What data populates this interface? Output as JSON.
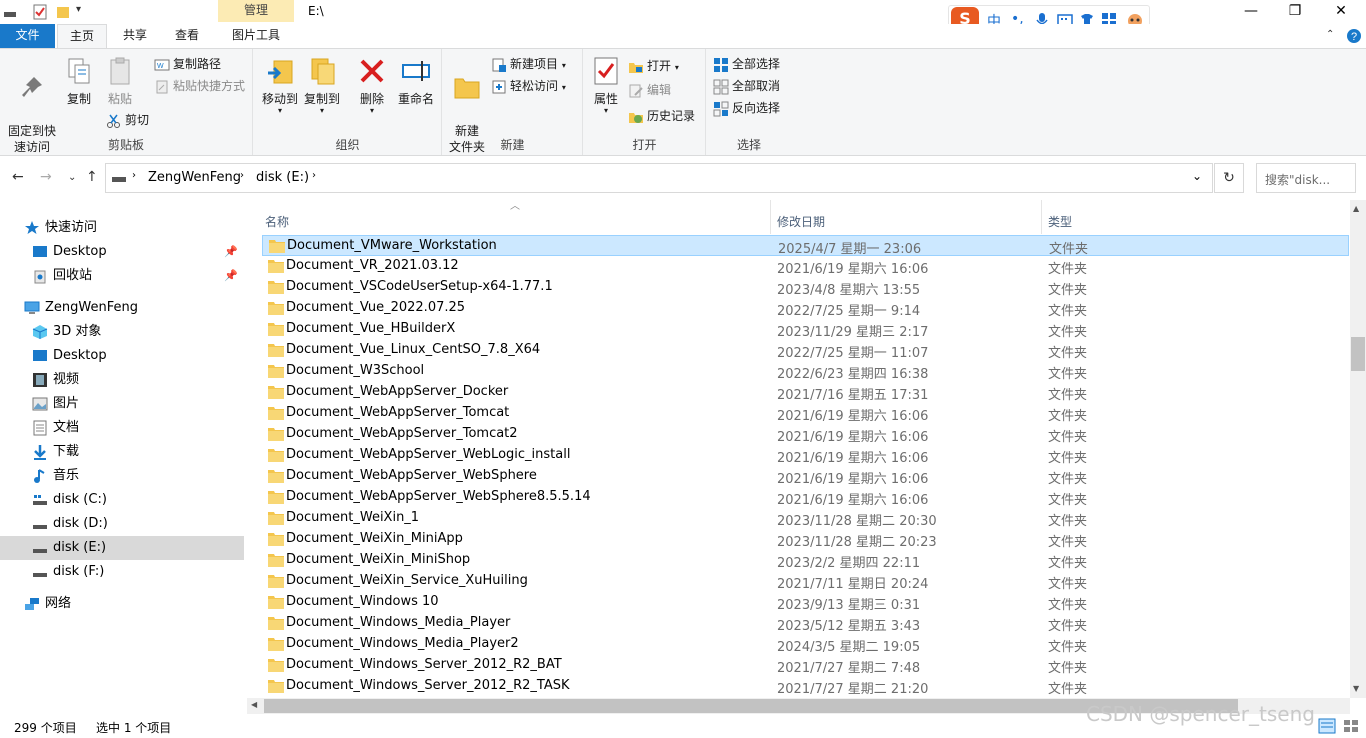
{
  "window": {
    "title": "E:\\",
    "context_tab": "管理",
    "controls": {
      "minimize": "—",
      "maximize": "❐",
      "close": "✕"
    }
  },
  "ime": {
    "logo": "S",
    "mode": "中",
    "punct": "•,"
  },
  "tabs": [
    {
      "label": "文件"
    },
    {
      "label": "主页"
    },
    {
      "label": "共享"
    },
    {
      "label": "查看"
    },
    {
      "label": "图片工具"
    }
  ],
  "ribbon": {
    "clipboard": {
      "label": "剪贴板",
      "pin": "固定到快\n速访问",
      "copy": "复制",
      "paste": "粘贴",
      "copy_path": "复制路径",
      "paste_shortcut": "粘贴快捷方式",
      "cut": "剪切"
    },
    "organize": {
      "label": "组织",
      "move_to": "移动到",
      "copy_to": "复制到",
      "delete": "删除",
      "rename": "重命名"
    },
    "new": {
      "label": "新建",
      "new_folder": "新建\n文件夹",
      "new_item": "新建项目",
      "easy_access": "轻松访问"
    },
    "open": {
      "label": "打开",
      "properties": "属性",
      "open": "打开",
      "edit": "编辑",
      "history": "历史记录"
    },
    "select": {
      "label": "选择",
      "select_all": "全部选择",
      "select_none": "全部取消",
      "invert": "反向选择"
    }
  },
  "address": {
    "crumbs": [
      "ZengWenFeng",
      "disk (E:)"
    ],
    "search_placeholder": "搜索\"disk..."
  },
  "navpane": {
    "quick_access": "快速访问",
    "quick_items": [
      {
        "label": "Desktop"
      },
      {
        "label": "回收站"
      }
    ],
    "this_pc": "ZengWenFeng",
    "pc_items": [
      {
        "label": "3D 对象"
      },
      {
        "label": "Desktop"
      },
      {
        "label": "视频"
      },
      {
        "label": "图片"
      },
      {
        "label": "文档"
      },
      {
        "label": "下载"
      },
      {
        "label": "音乐"
      },
      {
        "label": "disk (C:)"
      },
      {
        "label": "disk (D:)"
      },
      {
        "label": "disk (E:)"
      },
      {
        "label": "disk (F:)"
      }
    ],
    "network": "网络"
  },
  "columns": {
    "name": "名称",
    "date": "修改日期",
    "type": "类型"
  },
  "files": [
    {
      "name": "Document_VMware_Workstation",
      "date": "2025/4/7 星期一 23:06",
      "type": "文件夹"
    },
    {
      "name": "Document_VR_2021.03.12",
      "date": "2021/6/19 星期六 16:06",
      "type": "文件夹"
    },
    {
      "name": "Document_VSCodeUserSetup-x64-1.77.1",
      "date": "2023/4/8 星期六 13:55",
      "type": "文件夹"
    },
    {
      "name": "Document_Vue_2022.07.25",
      "date": "2022/7/25 星期一 9:14",
      "type": "文件夹"
    },
    {
      "name": "Document_Vue_HBuilderX",
      "date": "2023/11/29 星期三 2:17",
      "type": "文件夹"
    },
    {
      "name": "Document_Vue_Linux_CentSO_7.8_X64",
      "date": "2022/7/25 星期一 11:07",
      "type": "文件夹"
    },
    {
      "name": "Document_W3School",
      "date": "2022/6/23 星期四 16:38",
      "type": "文件夹"
    },
    {
      "name": "Document_WebAppServer_Docker",
      "date": "2021/7/16 星期五 17:31",
      "type": "文件夹"
    },
    {
      "name": "Document_WebAppServer_Tomcat",
      "date": "2021/6/19 星期六 16:06",
      "type": "文件夹"
    },
    {
      "name": "Document_WebAppServer_Tomcat2",
      "date": "2021/6/19 星期六 16:06",
      "type": "文件夹"
    },
    {
      "name": "Document_WebAppServer_WebLogic_install",
      "date": "2021/6/19 星期六 16:06",
      "type": "文件夹"
    },
    {
      "name": "Document_WebAppServer_WebSphere",
      "date": "2021/6/19 星期六 16:06",
      "type": "文件夹"
    },
    {
      "name": "Document_WebAppServer_WebSphere8.5.5.14",
      "date": "2021/6/19 星期六 16:06",
      "type": "文件夹"
    },
    {
      "name": "Document_WeiXin_1",
      "date": "2023/11/28 星期二 20:30",
      "type": "文件夹"
    },
    {
      "name": "Document_WeiXin_MiniApp",
      "date": "2023/11/28 星期二 20:23",
      "type": "文件夹"
    },
    {
      "name": "Document_WeiXin_MiniShop",
      "date": "2023/2/2 星期四 22:11",
      "type": "文件夹"
    },
    {
      "name": "Document_WeiXin_Service_XuHuiling",
      "date": "2021/7/11 星期日 20:24",
      "type": "文件夹"
    },
    {
      "name": "Document_Windows 10",
      "date": "2023/9/13 星期三 0:31",
      "type": "文件夹"
    },
    {
      "name": "Document_Windows_Media_Player",
      "date": "2023/5/12 星期五 3:43",
      "type": "文件夹"
    },
    {
      "name": "Document_Windows_Media_Player2",
      "date": "2024/3/5 星期二 19:05",
      "type": "文件夹"
    },
    {
      "name": "Document_Windows_Server_2012_R2_BAT",
      "date": "2021/7/27 星期二 7:48",
      "type": "文件夹"
    },
    {
      "name": "Document_Windows_Server_2012_R2_TASK",
      "date": "2021/7/27 星期二 21:20",
      "type": "文件夹"
    }
  ],
  "status": {
    "count": "299 个项目",
    "selected": "选中 1 个项目"
  },
  "watermark": "CSDN @spencer_tseng"
}
